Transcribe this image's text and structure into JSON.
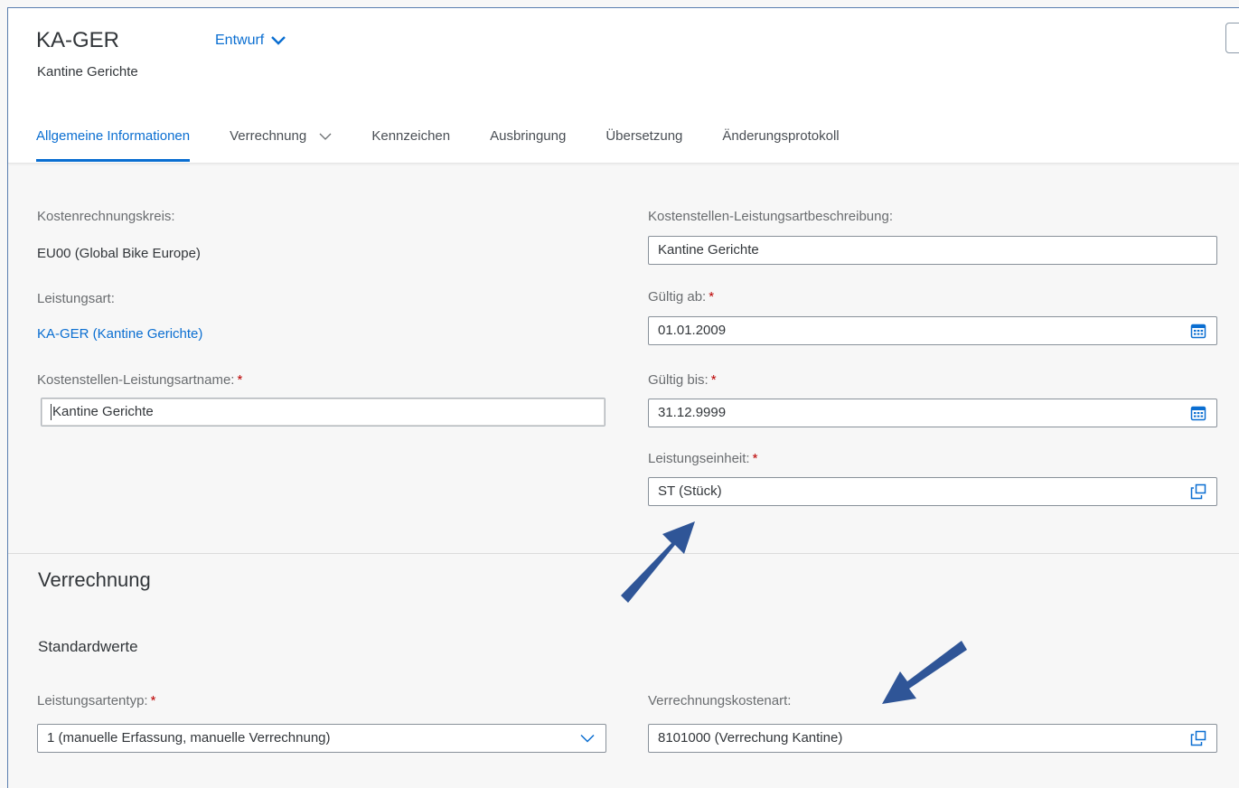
{
  "header": {
    "title": "KA-GER",
    "subtitle": "Kantine Gerichte",
    "status": "Entwurf"
  },
  "tabs": [
    {
      "label": "Allgemeine Informationen",
      "active": true
    },
    {
      "label": "Verrechnung",
      "has_dropdown": true
    },
    {
      "label": "Kennzeichen"
    },
    {
      "label": "Ausbringung"
    },
    {
      "label": "Übersetzung"
    },
    {
      "label": "Änderungsprotokoll"
    }
  ],
  "general": {
    "kokrs_label": "Kostenrechnungskreis:",
    "kokrs_value": "EU00 (Global Bike Europe)",
    "lstar_label": "Leistungsart:",
    "lstar_value": "KA-GER (Kantine Gerichte)",
    "name_label": "Kostenstellen-Leistungsartname:",
    "name_value": "Kantine Gerichte",
    "desc_label": "Kostenstellen-Leistungsartbeschreibung:",
    "desc_value": "Kantine Gerichte",
    "valid_from_label": "Gültig ab:",
    "valid_from_value": "01.01.2009",
    "valid_to_label": "Gültig bis:",
    "valid_to_value": "31.12.9999",
    "unit_label": "Leistungseinheit:",
    "unit_value": "ST (Stück)",
    "required_marker": "*"
  },
  "verrechnung": {
    "section_title": "Verrechnung",
    "subsection_title": "Standardwerte",
    "type_label": "Leistungsartentyp:",
    "type_value": "1 (manuelle Erfassung, manuelle Verrechnung)",
    "cost_elem_label": "Verrechnungskostenart:",
    "cost_elem_value": "8101000 (Verrechung Kantine)"
  },
  "colors": {
    "accent": "#0a6ed1",
    "required": "#bb0000",
    "annotation_arrow": "#2f5597"
  },
  "icons": [
    "chevron-down-icon",
    "calendar-icon",
    "value-help-icon"
  ]
}
